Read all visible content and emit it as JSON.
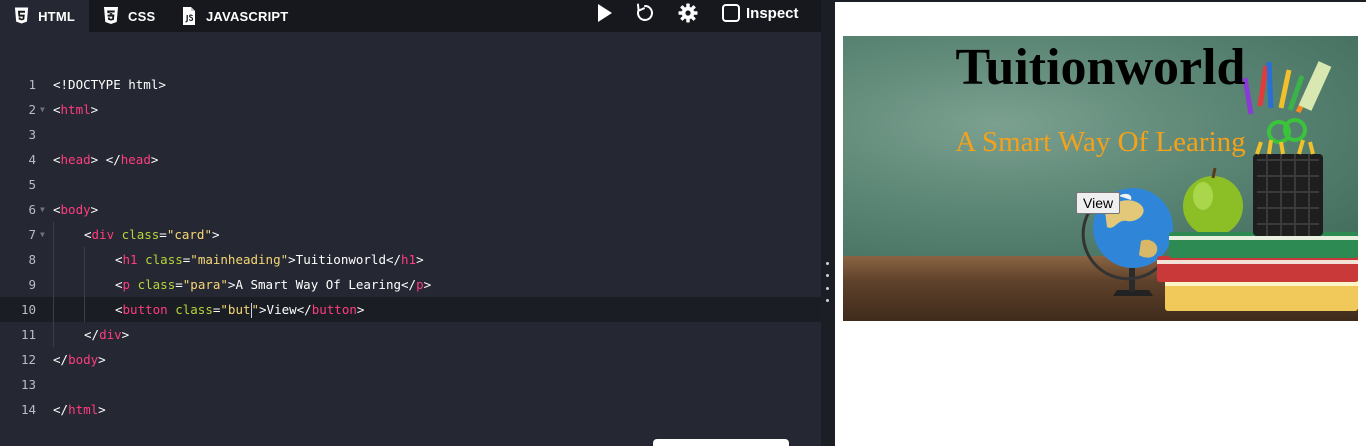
{
  "tabs": [
    {
      "label": "HTML",
      "icon": "html5-icon"
    },
    {
      "label": "CSS",
      "icon": "css3-icon"
    },
    {
      "label": "JAVASCRIPT",
      "icon": "js-file-icon"
    }
  ],
  "toolbar": {
    "run_icon": "play-icon",
    "reset_icon": "refresh-icon",
    "settings_icon": "gear-icon",
    "inspect_label": "Inspect"
  },
  "editor": {
    "lines": [
      {
        "n": "1",
        "fold": false,
        "indent": 0,
        "code": [
          [
            "t",
            "<!DOCTYPE html>"
          ]
        ]
      },
      {
        "n": "2",
        "fold": true,
        "indent": 0,
        "code": [
          [
            "t",
            "<"
          ],
          [
            "g",
            "html"
          ],
          [
            "t",
            ">"
          ]
        ]
      },
      {
        "n": "3",
        "fold": false,
        "indent": 0,
        "code": []
      },
      {
        "n": "4",
        "fold": false,
        "indent": 0,
        "code": [
          [
            "t",
            "<"
          ],
          [
            "g",
            "head"
          ],
          [
            "t",
            "> </"
          ],
          [
            "g",
            "head"
          ],
          [
            "t",
            ">"
          ]
        ]
      },
      {
        "n": "5",
        "fold": false,
        "indent": 0,
        "code": []
      },
      {
        "n": "6",
        "fold": true,
        "indent": 0,
        "code": [
          [
            "t",
            "<"
          ],
          [
            "g",
            "body"
          ],
          [
            "t",
            ">"
          ]
        ]
      },
      {
        "n": "7",
        "fold": true,
        "indent": 1,
        "code": [
          [
            "t",
            "<"
          ],
          [
            "g",
            "div"
          ],
          [
            "t",
            " "
          ],
          [
            "a",
            "class"
          ],
          [
            "t",
            "="
          ],
          [
            "s",
            "\"card\""
          ],
          [
            "t",
            ">"
          ]
        ]
      },
      {
        "n": "8",
        "fold": false,
        "indent": 2,
        "code": [
          [
            "t",
            "<"
          ],
          [
            "g",
            "h1"
          ],
          [
            "t",
            " "
          ],
          [
            "a",
            "class"
          ],
          [
            "t",
            "="
          ],
          [
            "s",
            "\"mainheading\""
          ],
          [
            "t",
            ">Tuitionworld</"
          ],
          [
            "g",
            "h1"
          ],
          [
            "t",
            ">"
          ]
        ]
      },
      {
        "n": "9",
        "fold": false,
        "indent": 2,
        "code": [
          [
            "t",
            "<"
          ],
          [
            "g",
            "p"
          ],
          [
            "t",
            " "
          ],
          [
            "a",
            "class"
          ],
          [
            "t",
            "="
          ],
          [
            "s",
            "\"para\""
          ],
          [
            "t",
            ">A Smart Way Of Learing</"
          ],
          [
            "g",
            "p"
          ],
          [
            "t",
            ">"
          ]
        ]
      },
      {
        "n": "10",
        "fold": false,
        "indent": 2,
        "current": true,
        "code": [
          [
            "t",
            "<"
          ],
          [
            "g",
            "button"
          ],
          [
            "t",
            " "
          ],
          [
            "a",
            "class"
          ],
          [
            "t",
            "="
          ],
          [
            "s",
            "\"but"
          ],
          [
            "c",
            ""
          ],
          [
            "s",
            "\""
          ],
          [
            "t",
            ">View</"
          ],
          [
            "g",
            "button"
          ],
          [
            "t",
            ">"
          ]
        ]
      },
      {
        "n": "11",
        "fold": false,
        "indent": 1,
        "code": [
          [
            "t",
            "</"
          ],
          [
            "g",
            "div"
          ],
          [
            "t",
            ">"
          ]
        ]
      },
      {
        "n": "12",
        "fold": false,
        "indent": 0,
        "code": [
          [
            "t",
            "</"
          ],
          [
            "g",
            "body"
          ],
          [
            "t",
            ">"
          ]
        ]
      },
      {
        "n": "13",
        "fold": false,
        "indent": 0,
        "code": []
      },
      {
        "n": "14",
        "fold": false,
        "indent": 0,
        "code": [
          [
            "t",
            "</"
          ],
          [
            "g",
            "html"
          ],
          [
            "t",
            ">"
          ]
        ]
      }
    ]
  },
  "preview": {
    "heading": "Tuitionworld",
    "para": "A Smart Way Of Learing",
    "button": "View"
  },
  "colors": {
    "editor_bg": "#252833",
    "tag": "#ff3c7e",
    "attr": "#b7d33a",
    "string": "#f7d774",
    "para_text": "#f5a21a"
  }
}
